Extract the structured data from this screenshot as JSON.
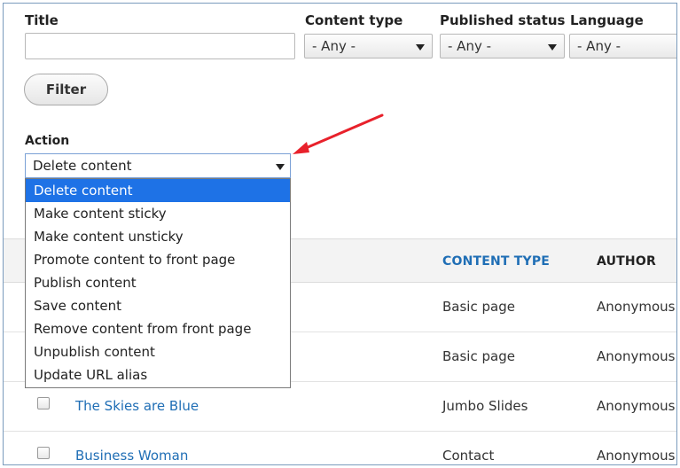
{
  "filters": {
    "title_label": "Title",
    "title_value": "",
    "content_type_label": "Content type",
    "content_type_value": "- Any -",
    "published_status_label": "Published status",
    "published_status_value": "- Any -",
    "language_label": "Language",
    "language_value": "- Any -",
    "filter_button": "Filter"
  },
  "action": {
    "label": "Action",
    "selected": "Delete content",
    "options": [
      "Delete content",
      "Make content sticky",
      "Make content unsticky",
      "Promote content to front page",
      "Publish content",
      "Save content",
      "Remove content from front page",
      "Unpublish content",
      "Update URL alias"
    ]
  },
  "annotation": {
    "arrow_color": "#e8212b"
  },
  "table": {
    "headers": {
      "content_type": "CONTENT TYPE",
      "author": "AUTHOR"
    },
    "header_link_color": "#1f6eb5",
    "rows": [
      {
        "title": "",
        "content_type": "Basic page",
        "author": "Anonymous"
      },
      {
        "title": "",
        "content_type": "Basic page",
        "author": "Anonymous"
      },
      {
        "title": "The Skies are Blue",
        "content_type": "Jumbo Slides",
        "author": "Anonymous"
      },
      {
        "title": "Business Woman",
        "content_type": "Contact",
        "author": "Anonymous"
      }
    ]
  }
}
